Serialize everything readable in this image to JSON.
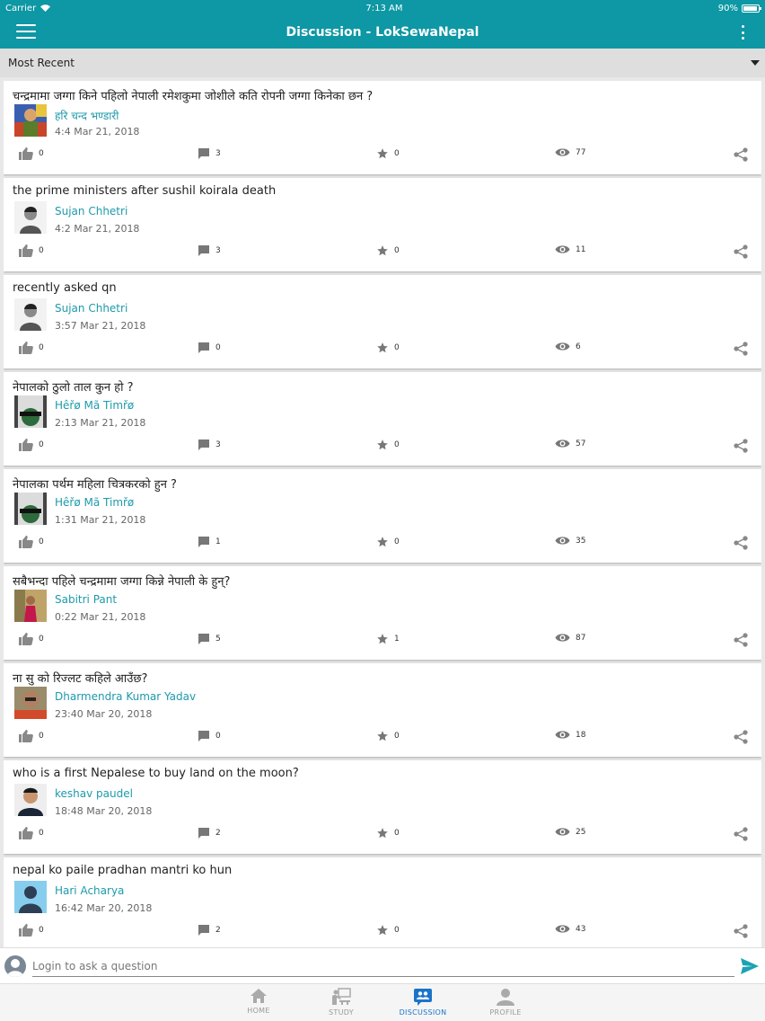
{
  "status_bar": {
    "carrier": "Carrier",
    "time": "7:13 AM",
    "battery": "90%"
  },
  "app_bar": {
    "title": "Discussion - LokSewaNepal"
  },
  "filter": {
    "label": "Most Recent"
  },
  "posts": [
    {
      "question": "चन्द्रमामा जग्गा किने पहिलो नेपाली रमेशकुमा जोशीले कति रोपनी जग्गा किनेका छन ?",
      "author": "हरि चन्द भण्डारी",
      "time": "4:4 Mar 21, 2018",
      "likes": "0",
      "comments": "3",
      "stars": "0",
      "views": "77",
      "avatar": "photo-colorful"
    },
    {
      "question": "the prime ministers after sushil koirala death",
      "author": "Sujan Chhetri",
      "time": "4:2 Mar 21, 2018",
      "likes": "0",
      "comments": "3",
      "stars": "0",
      "views": "11",
      "avatar": "photo-portrait"
    },
    {
      "question": "recently asked qn",
      "author": "Sujan Chhetri",
      "time": "3:57 Mar 21, 2018",
      "likes": "0",
      "comments": "0",
      "stars": "0",
      "views": "6",
      "avatar": "photo-portrait"
    },
    {
      "question": "नेपालको ठुलो ताल कुन हो ?",
      "author": "Hêřø Mã Timřø",
      "time": "2:13 Mar 21, 2018",
      "likes": "0",
      "comments": "3",
      "stars": "0",
      "views": "57",
      "avatar": "photo-film"
    },
    {
      "question": "नेपालका पर्थम महिला चित्रकरको हुन ?",
      "author": "Hêřø Mã Timřø",
      "time": "1:31 Mar 21, 2018",
      "likes": "0",
      "comments": "1",
      "stars": "0",
      "views": "35",
      "avatar": "photo-film"
    },
    {
      "question": "सबैभन्दा पहिले चन्द्रमामा जग्गा किन्ने नेपाली के हुन्?",
      "author": "Sabitri Pant",
      "time": "0:22 Mar 21, 2018",
      "likes": "0",
      "comments": "5",
      "stars": "1",
      "views": "87",
      "avatar": "photo-woman"
    },
    {
      "question": " ना सु को रिज्लट कहिले आउँछ?",
      "author": "Dharmendra Kumar Yadav",
      "time": "23:40 Mar 20, 2018",
      "likes": "0",
      "comments": "0",
      "stars": "0",
      "views": "18",
      "avatar": "photo-man"
    },
    {
      "question": "who is a first Nepalese to buy land on the moon?",
      "author": "keshav paudel",
      "time": "18:48 Mar 20, 2018",
      "likes": "0",
      "comments": "2",
      "stars": "0",
      "views": "25",
      "avatar": "photo-selfie"
    },
    {
      "question": "nepal ko paile pradhan mantri ko hun",
      "author": "Hari Acharya",
      "time": "16:42 Mar 20, 2018",
      "likes": "0",
      "comments": "2",
      "stars": "0",
      "views": "43",
      "avatar": "default-user"
    }
  ],
  "ask_bar": {
    "placeholder": "Login to ask a question"
  },
  "bottom_nav": {
    "items": [
      {
        "label": "HOME",
        "icon": "home-icon"
      },
      {
        "label": "STUDY",
        "icon": "study-icon"
      },
      {
        "label": "DISCUSSION",
        "icon": "discussion-icon",
        "active": true
      },
      {
        "label": "PROFILE",
        "icon": "profile-icon"
      }
    ]
  },
  "colors": {
    "primary": "#0e97a4",
    "author_link": "#1d9aab",
    "active_nav": "#1a74c9"
  }
}
